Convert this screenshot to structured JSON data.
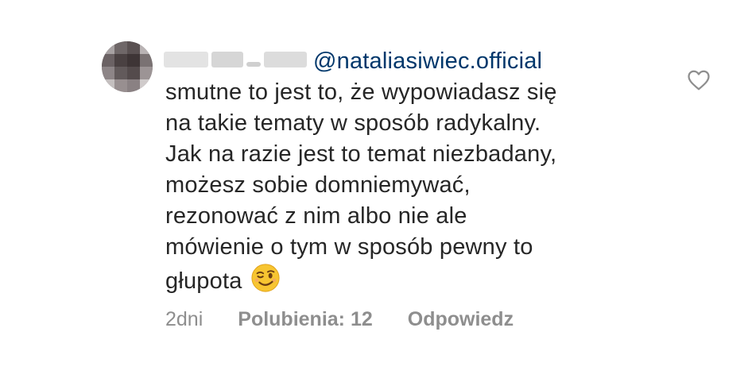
{
  "comment": {
    "mention": "@nataliasiwiec.official",
    "lines": [
      "smutne to jest to, że wypowiadasz się",
      "na takie tematy w sposób radykalny.",
      "Jak na razie jest to temat niezbadany,",
      "możesz sobie domniemywać,",
      "rezonować z nim albo nie ale",
      "mówienie o tym w sposób pewny to",
      "głupota"
    ],
    "emoji": "winking-face"
  },
  "meta": {
    "time": "2dni",
    "likes": "Polubienia: 12",
    "reply": "Odpowiedz"
  },
  "colors": {
    "text": "#262626",
    "mention": "#00376b",
    "meta": "#8e8e8e"
  }
}
